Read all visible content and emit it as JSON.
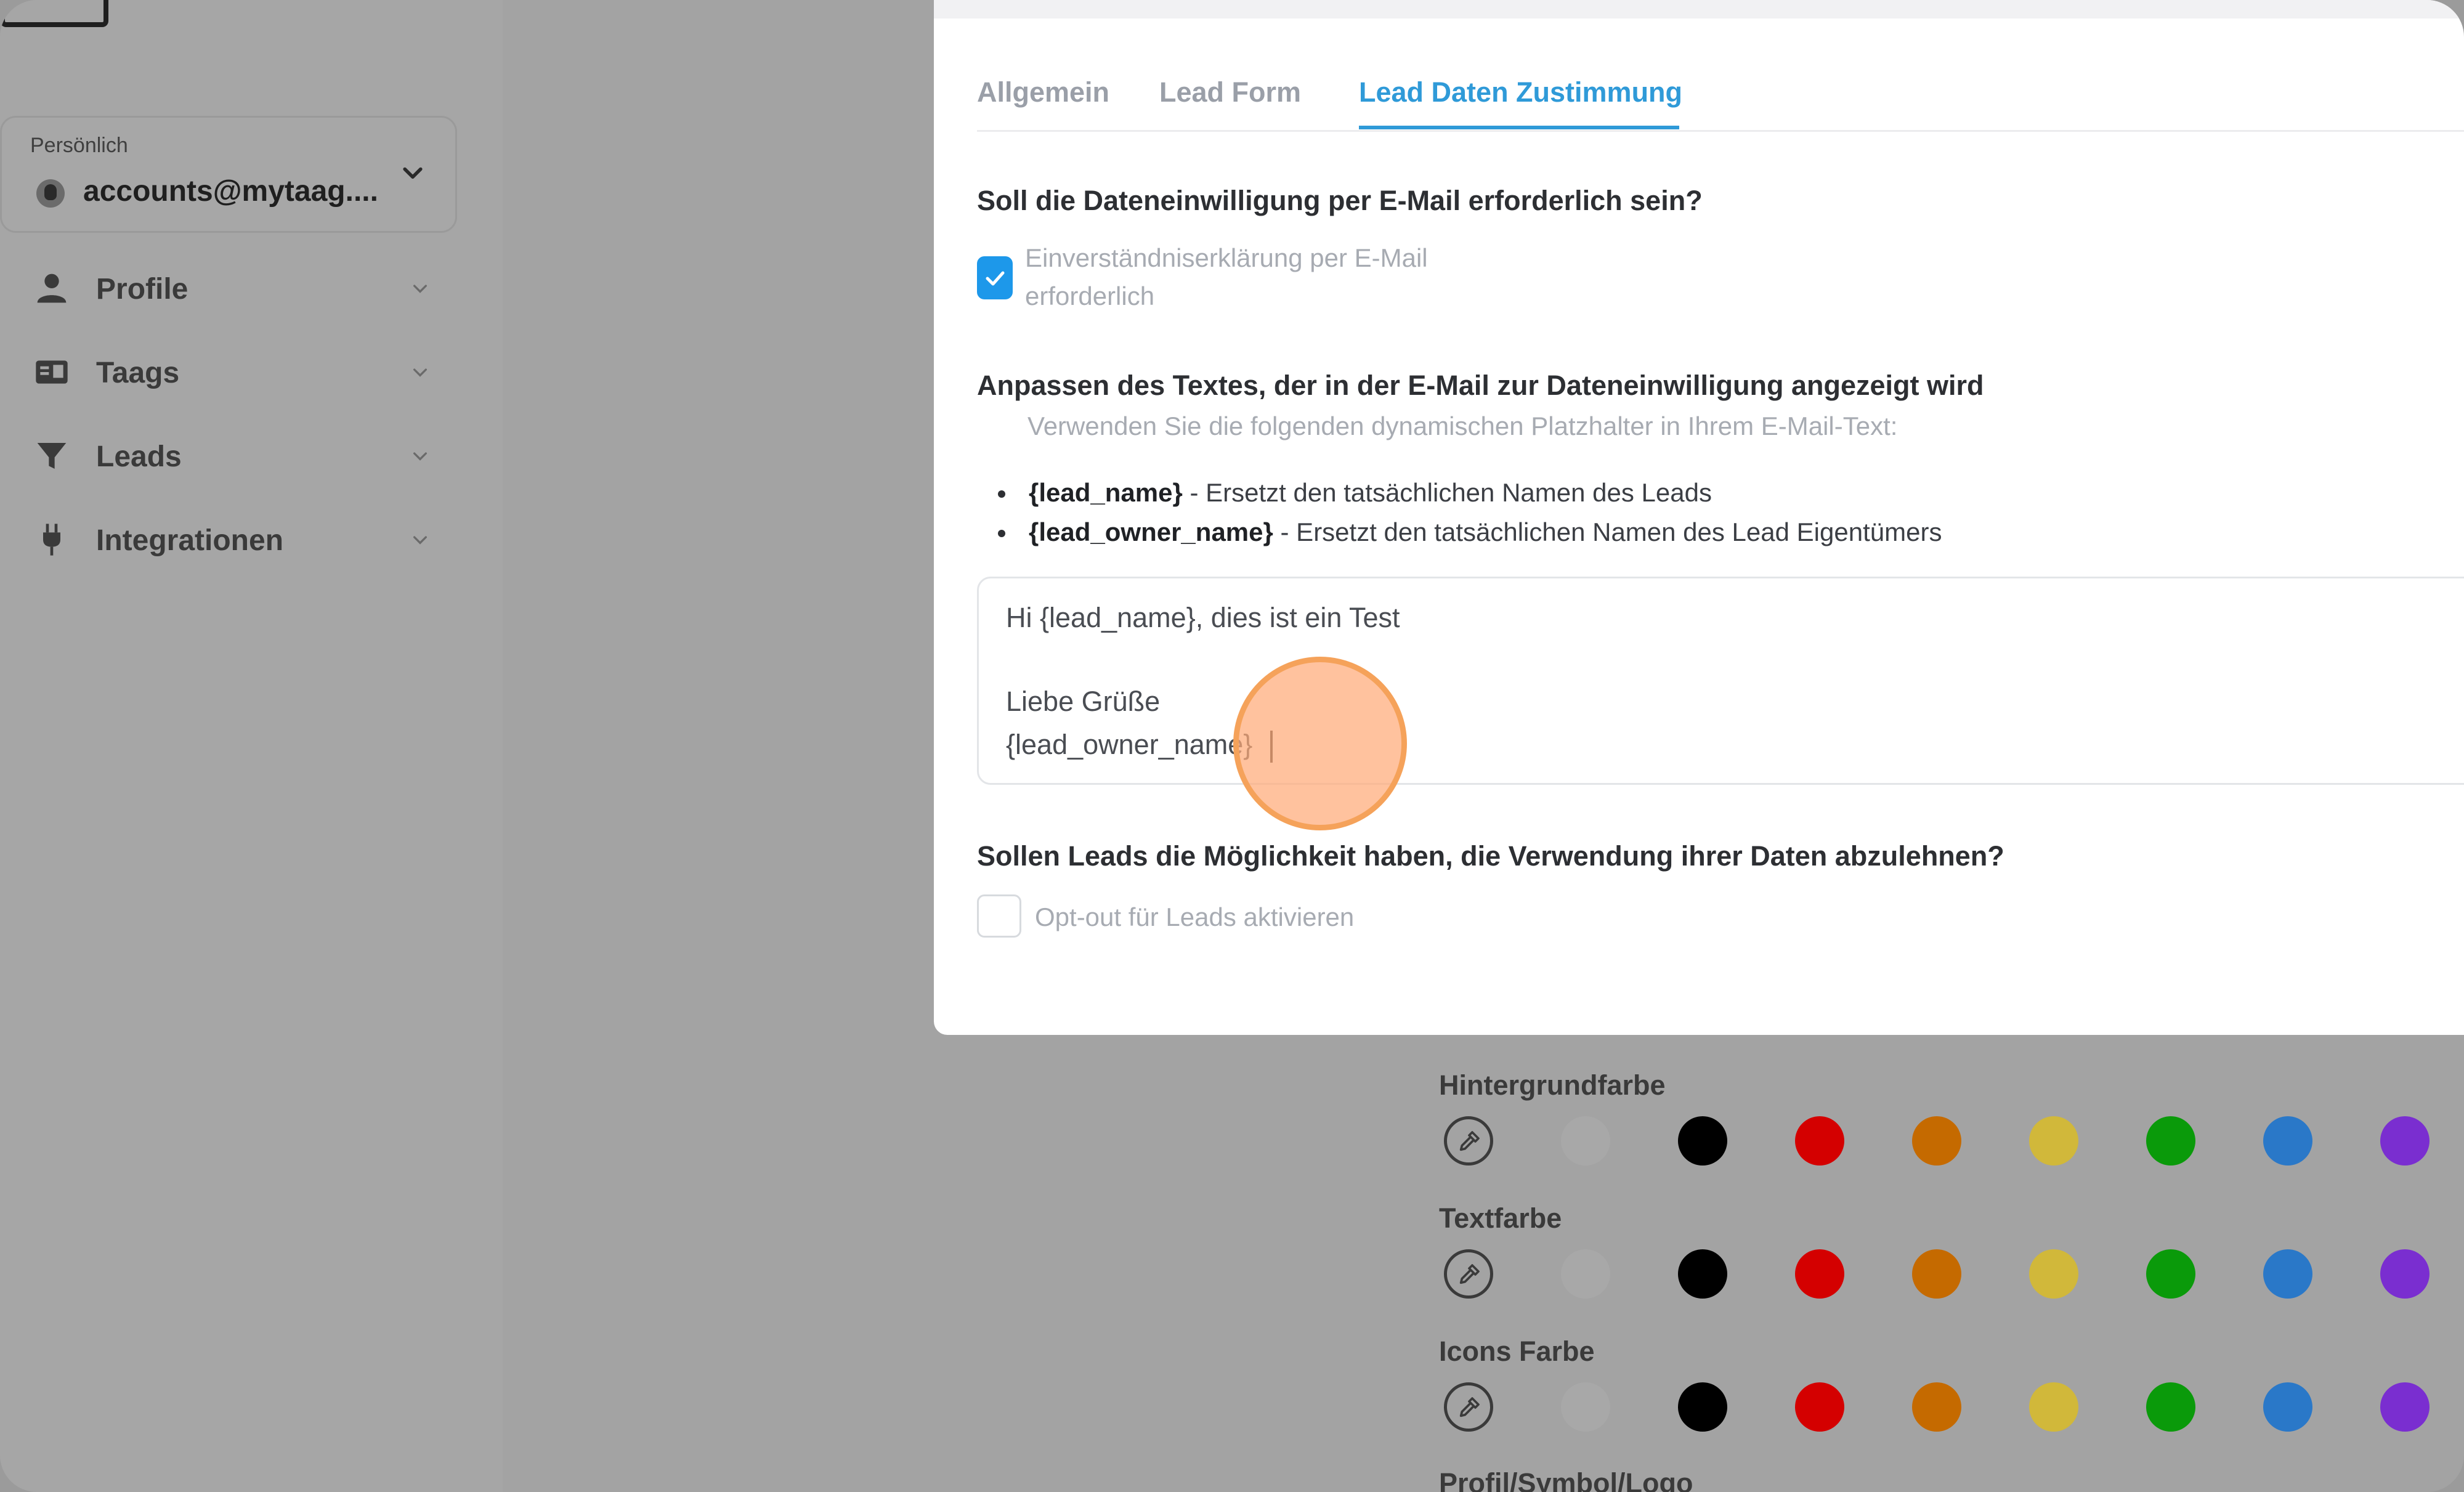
{
  "sidebar": {
    "account": {
      "label": "Persönlich",
      "email": "accounts@mytaag...."
    },
    "items": [
      {
        "label": "Profile",
        "icon": "person-icon"
      },
      {
        "label": "Taags",
        "icon": "card-icon"
      },
      {
        "label": "Leads",
        "icon": "funnel-icon"
      },
      {
        "label": "Integrationen",
        "icon": "plug-icon"
      }
    ]
  },
  "modal": {
    "tabs": [
      {
        "label": "Allgemein",
        "active": false
      },
      {
        "label": "Lead Form",
        "active": false
      },
      {
        "label": "Lead Daten Zustimmung",
        "active": true
      }
    ],
    "q1": "Soll die Dateneinwilligung per E-Mail erforderlich sein?",
    "checkbox1_line1": "Einverständniserklärung per E-Mail",
    "checkbox1_line2": "erforderlich",
    "q2": "Anpassen des Textes, der in der E-Mail zur Dateneinwilligung angezeigt wird",
    "hint": "Verwenden Sie die folgenden dynamischen Platzhalter in Ihrem E-Mail-Text:",
    "bullets": [
      {
        "key": "{lead_name}",
        "desc": " - Ersetzt den tatsächlichen Namen des Leads"
      },
      {
        "key": "{lead_owner_name}",
        "desc": " - Ersetzt den tatsächlichen Namen des Lead Eigentümers"
      }
    ],
    "textarea_lines": [
      "Hi {lead_name}, dies ist ein Test",
      "Liebe Grüße",
      "{lead_owner_name}"
    ],
    "q3": "Sollen Leads die Möglichkeit haben, die Verwendung ihrer Daten abzulehnen?",
    "checkbox2_label": "Opt-out für Leads aktivieren"
  },
  "colors": {
    "sections": [
      "Hintergrundfarbe",
      "Textfarbe",
      "Icons Farbe",
      "Profil/Symbol/Logo"
    ],
    "swatches": [
      "#a8a8a8",
      "#000000",
      "#d40000",
      "#c56a00",
      "#d1b83a",
      "#0a9a0a",
      "#2a78c8",
      "#7a2ed0"
    ]
  },
  "accent": "#2f9ad8"
}
